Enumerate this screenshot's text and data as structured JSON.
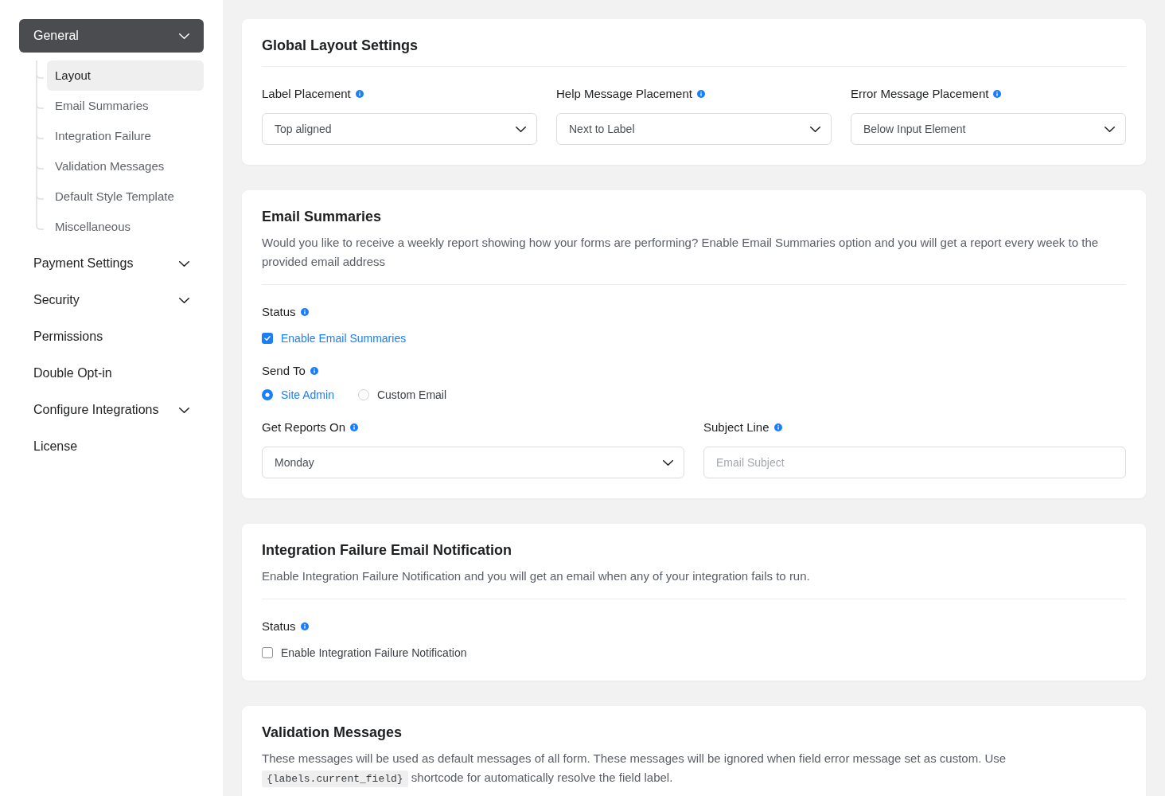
{
  "sidebar": {
    "items": [
      {
        "kind": "group",
        "label": "General",
        "expanded": true,
        "children": [
          {
            "label": "Layout",
            "selected": true
          },
          {
            "label": "Email Summaries",
            "selected": false
          },
          {
            "label": "Integration Failure",
            "selected": false
          },
          {
            "label": "Validation Messages",
            "selected": false
          },
          {
            "label": "Default Style Template",
            "selected": false
          },
          {
            "label": "Miscellaneous",
            "selected": false
          }
        ]
      },
      {
        "kind": "group",
        "label": "Payment Settings",
        "expanded": false
      },
      {
        "kind": "group",
        "label": "Security",
        "expanded": false
      },
      {
        "kind": "link",
        "label": "Permissions"
      },
      {
        "kind": "link",
        "label": "Double Opt-in"
      },
      {
        "kind": "group",
        "label": "Configure Integrations",
        "expanded": false
      },
      {
        "kind": "link",
        "label": "License"
      }
    ]
  },
  "cards": [
    {
      "title": "Global Layout Settings",
      "rows": [
        [
          {
            "kind": "select",
            "label": "Label Placement",
            "value": "Top aligned"
          },
          {
            "kind": "select",
            "label": "Help Message Placement",
            "value": "Next to Label"
          },
          {
            "kind": "select",
            "label": "Error Message Placement",
            "value": "Below Input Element"
          }
        ]
      ]
    },
    {
      "title": "Email Summaries",
      "description": [
        {
          "kind": "text",
          "text": "Would you like to receive a weekly report showing how your forms are performing? Enable Email Summaries option and you will get a report every week to the provided email address"
        }
      ],
      "rows": [
        [
          {
            "kind": "checkbox",
            "label": "Status",
            "option": {
              "label": "Enable Email Summaries",
              "checked": true
            }
          }
        ],
        [
          {
            "kind": "radio",
            "label": "Send To",
            "options": [
              {
                "label": "Site Admin",
                "selected": true
              },
              {
                "label": "Custom Email",
                "selected": false
              }
            ]
          }
        ],
        [
          {
            "kind": "select",
            "label": "Get Reports On",
            "value": "Monday"
          },
          {
            "kind": "text",
            "label": "Subject Line",
            "placeholder": "Email Subject"
          }
        ]
      ]
    },
    {
      "title": "Integration Failure Email Notification",
      "description": [
        {
          "kind": "text",
          "text": "Enable Integration Failure Notification and you will get an email when any of your integration fails to run."
        }
      ],
      "rows": [
        [
          {
            "kind": "checkbox",
            "label": "Status",
            "option": {
              "label": "Enable Integration Failure Notification",
              "checked": false
            }
          }
        ]
      ]
    },
    {
      "title": "Validation Messages",
      "description": [
        {
          "kind": "text",
          "text": "These messages will be used as default messages of all form. These messages will be ignored when field error message set as custom. Use"
        },
        {
          "kind": "code",
          "text": "{labels.current_field}"
        },
        {
          "kind": "text",
          "text": "shortcode for automatically resolve the field label."
        }
      ]
    }
  ]
}
